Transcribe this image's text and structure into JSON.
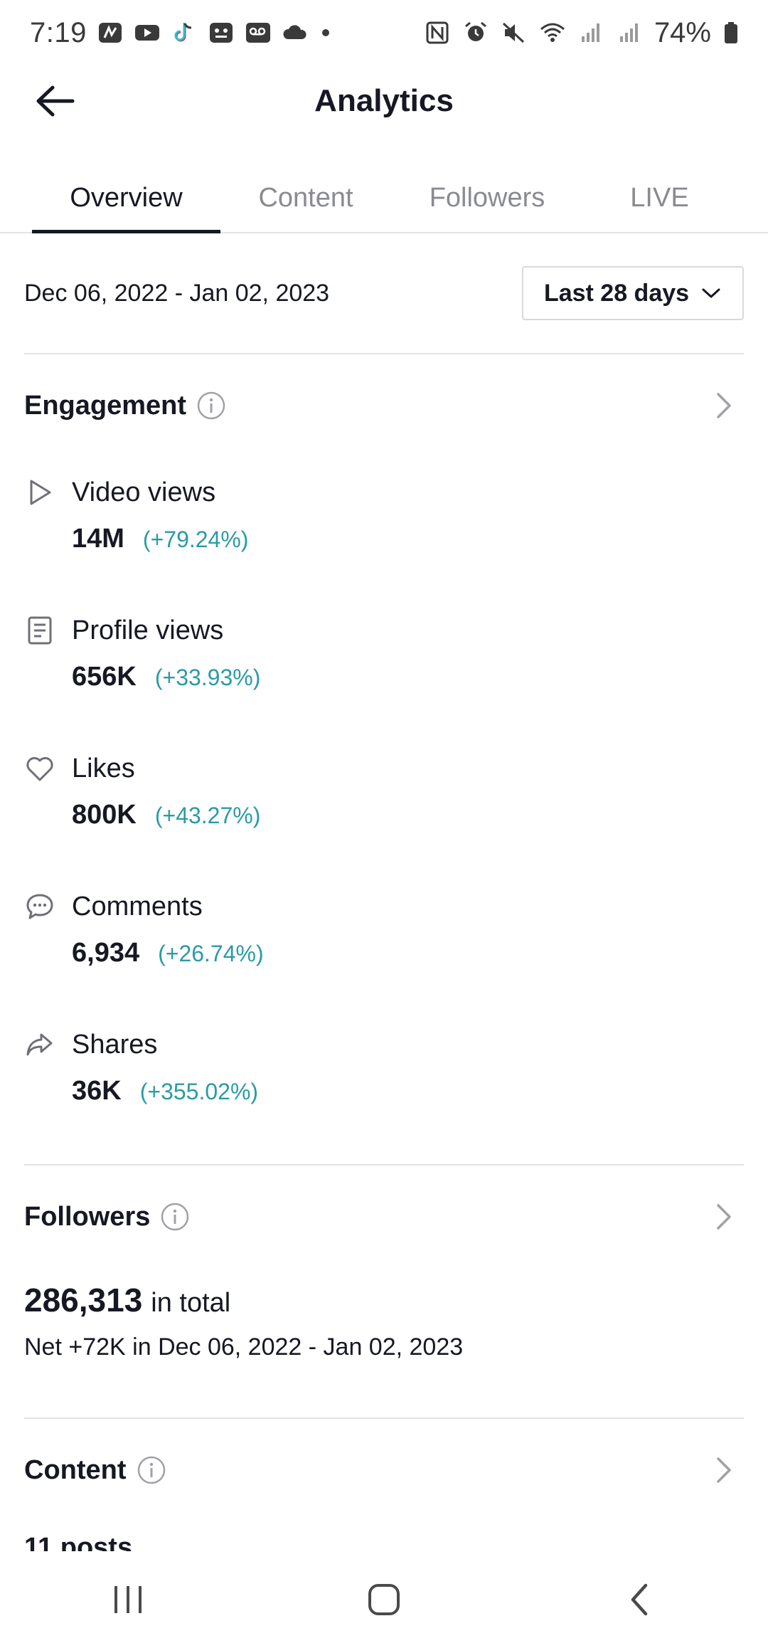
{
  "status_bar": {
    "time": "7:19",
    "battery": "74%",
    "left_icons": [
      "nfc-app-icon",
      "youtube-icon",
      "tiktok-icon",
      "app-icon",
      "voicemail-icon",
      "cloud-icon",
      "dot-icon"
    ],
    "right_icons": [
      "nfc-icon",
      "alarm-icon",
      "mute-icon",
      "wifi-icon",
      "signal-icon",
      "signal-icon",
      "battery-icon"
    ]
  },
  "header": {
    "title": "Analytics",
    "back_icon": "arrow-left-icon"
  },
  "tabs": [
    {
      "label": "Overview",
      "active": true
    },
    {
      "label": "Content",
      "active": false
    },
    {
      "label": "Followers",
      "active": false
    },
    {
      "label": "LIVE",
      "active": false
    }
  ],
  "date_filter": {
    "range": "Dec 06, 2022 - Jan 02, 2023",
    "selected": "Last 28 days"
  },
  "engagement": {
    "title": "Engagement",
    "metrics": [
      {
        "icon": "play-icon",
        "label": "Video views",
        "value": "14M",
        "change": "(+79.24%)"
      },
      {
        "icon": "profile-icon",
        "label": "Profile views",
        "value": "656K",
        "change": "(+33.93%)"
      },
      {
        "icon": "heart-icon",
        "label": "Likes",
        "value": "800K",
        "change": "(+43.27%)"
      },
      {
        "icon": "comment-icon",
        "label": "Comments",
        "value": "6,934",
        "change": "(+26.74%)"
      },
      {
        "icon": "share-icon",
        "label": "Shares",
        "value": "36K",
        "change": "(+355.02%)"
      }
    ]
  },
  "followers": {
    "title": "Followers",
    "total": "286,313",
    "total_suffix": "in total",
    "net": "Net +72K in Dec 06, 2022 - Jan 02, 2023"
  },
  "content": {
    "title": "Content",
    "peek_text": "11 posts"
  },
  "colors": {
    "accent_teal": "#2a9ba6",
    "text_primary": "#161823",
    "text_secondary": "#8a8b91"
  }
}
